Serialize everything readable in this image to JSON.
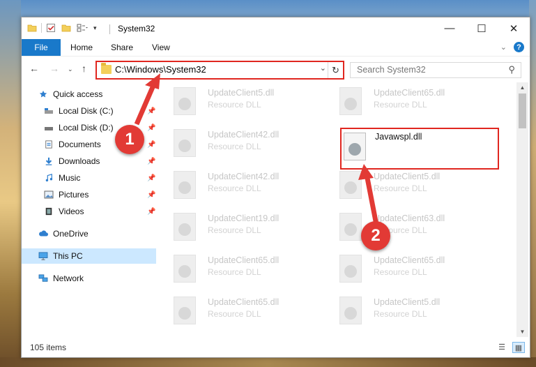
{
  "window": {
    "title": "System32",
    "controls": {
      "minimize": "—",
      "maximize": "☐",
      "close": "✕"
    }
  },
  "ribbon": {
    "tabs": [
      "File",
      "Home",
      "Share",
      "View"
    ],
    "expand_icon": "chevron-down-icon",
    "help_label": "?"
  },
  "navigation": {
    "address_path": "C:\\Windows\\System32",
    "search_placeholder": "Search System32"
  },
  "sidebar": {
    "items": [
      {
        "label": "Quick access",
        "icon": "star-icon"
      },
      {
        "label": "Local Disk (C:)",
        "icon": "drive-icon",
        "pinned": true
      },
      {
        "label": "Local Disk (D:)",
        "icon": "drive-icon",
        "pinned": true
      },
      {
        "label": "Documents",
        "icon": "documents-icon",
        "pinned": true
      },
      {
        "label": "Downloads",
        "icon": "download-icon",
        "pinned": true
      },
      {
        "label": "Music",
        "icon": "music-icon",
        "pinned": true
      },
      {
        "label": "Pictures",
        "icon": "pictures-icon",
        "pinned": true
      },
      {
        "label": "Videos",
        "icon": "videos-icon",
        "pinned": true
      },
      {
        "label": "OneDrive",
        "icon": "cloud-icon"
      },
      {
        "label": "This PC",
        "icon": "computer-icon",
        "selected": true
      },
      {
        "label": "Network",
        "icon": "network-icon"
      }
    ]
  },
  "files": [
    {
      "name": "UpdateClient5.dll",
      "type": "Resource DLL"
    },
    {
      "name": "UpdateClient65.dll",
      "type": "Resource DLL"
    },
    {
      "name": "UpdateClient42.dll",
      "type": "Resource DLL"
    },
    {
      "name": "Javawspl.dll",
      "type": "",
      "highlighted": true
    },
    {
      "name": "UpdateClient42.dll",
      "type": "Resource DLL"
    },
    {
      "name": "UpdateClient5.dll",
      "type": "Resource DLL"
    },
    {
      "name": "UpdateClient19.dll",
      "type": "Resource DLL"
    },
    {
      "name": "UpdateClient63.dll",
      "type": "Resource DLL"
    },
    {
      "name": "UpdateClient65.dll",
      "type": "Resource DLL"
    },
    {
      "name": "UpdateClient65.dll",
      "type": "Resource DLL"
    },
    {
      "name": "UpdateClient65.dll",
      "type": "Resource DLL"
    },
    {
      "name": "UpdateClient5.dll",
      "type": "Resource DLL"
    }
  ],
  "status": {
    "item_count": "105 items"
  },
  "annotations": {
    "step1": "1",
    "step2": "2",
    "color": "#e23a35"
  },
  "colors": {
    "accent": "#1979ca",
    "highlight_border": "#e0261f",
    "selected_bg": "#cce8ff"
  }
}
